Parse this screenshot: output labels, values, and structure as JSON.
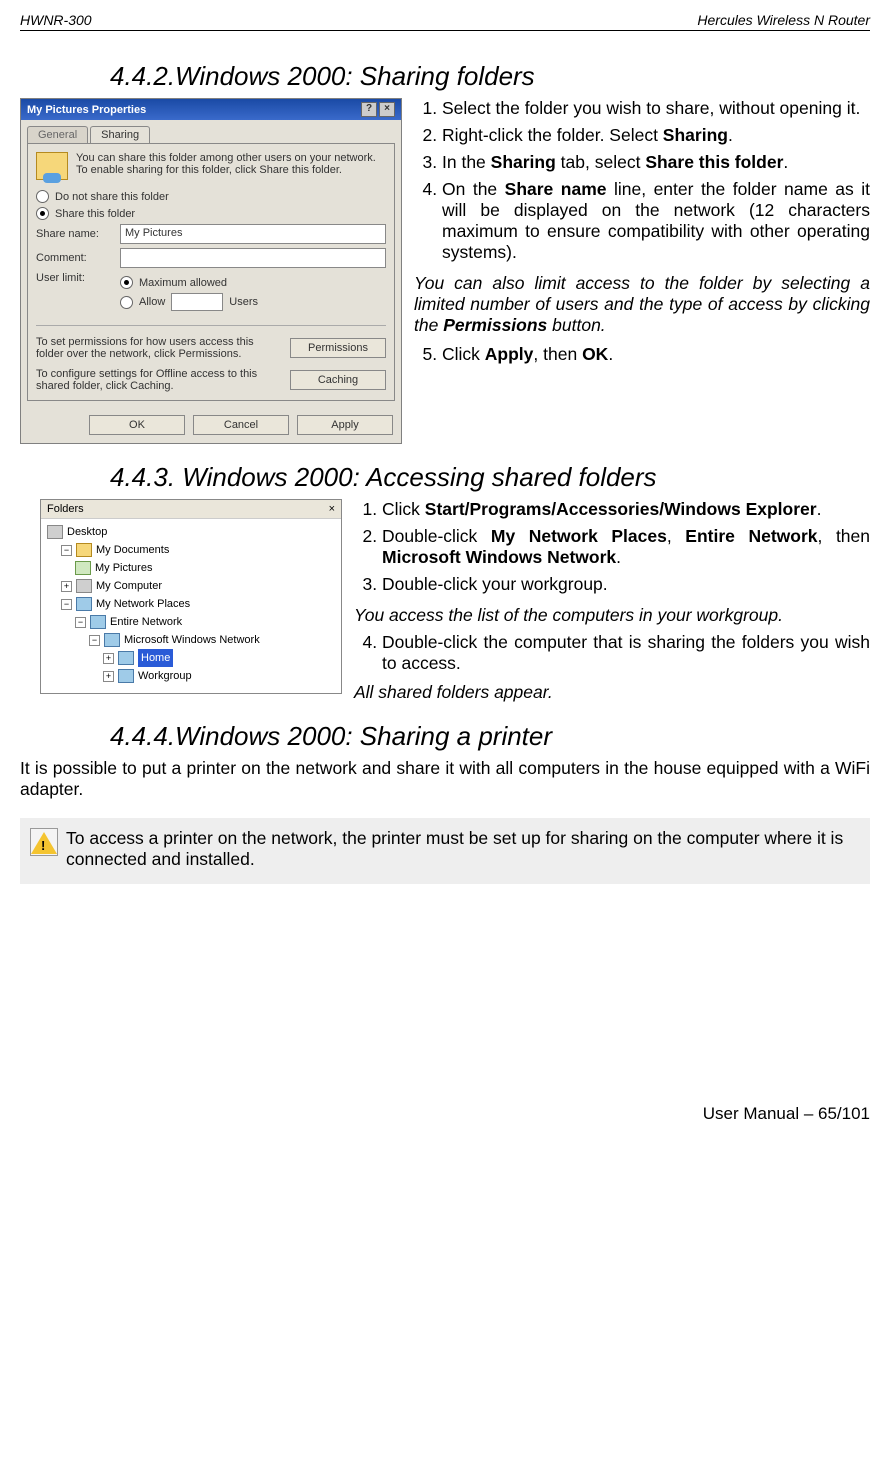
{
  "header": {
    "left": "HWNR-300",
    "right": "Hercules Wireless N Router"
  },
  "section_442": {
    "title": "4.4.2.Windows 2000: Sharing folders",
    "dialog": {
      "title": "My Pictures Properties",
      "qmark": "?",
      "xmark": "×",
      "tab_general": "General",
      "tab_sharing": "Sharing",
      "desc": "You can share this folder among other users on your network.  To enable sharing for this folder, click Share this folder.",
      "radio_noshare": "Do not share this folder",
      "radio_share": "Share this folder",
      "label_sharename": "Share name:",
      "val_sharename": "My Pictures",
      "label_comment": "Comment:",
      "label_userlimit": "User limit:",
      "radio_max": "Maximum allowed",
      "radio_allow": "Allow",
      "users_suffix": "Users",
      "perm_desc": "To set permissions for how users access this folder over the network, click Permissions.",
      "btn_perm": "Permissions",
      "cache_desc": "To configure settings for Offline access to this shared folder, click Caching.",
      "btn_cache": "Caching",
      "btn_ok": "OK",
      "btn_cancel": "Cancel",
      "btn_apply": "Apply"
    },
    "steps": {
      "s1": "Select the folder you wish to share, without opening it.",
      "s2a": "Right-click the folder.  Select ",
      "s2b": "Sharing",
      "s2c": ".",
      "s3a": "In the ",
      "s3b": "Sharing",
      "s3c": " tab, select ",
      "s3d": "Share this folder",
      "s3e": ".",
      "s4a": "On the ",
      "s4b": "Share name",
      "s4c": " line, enter the folder name as it will be displayed on the network (12 characters maximum to ensure compatibility with other operating systems).",
      "note_a": "You can also limit access to the folder by selecting a limited number of users and the type of access by clicking the ",
      "note_b": "Permissions",
      "note_c": " button.",
      "s5a": "Click ",
      "s5b": "Apply",
      "s5c": ", then ",
      "s5d": "OK",
      "s5e": "."
    }
  },
  "section_443": {
    "title": "4.4.3.  Windows 2000: Accessing shared folders",
    "tree": {
      "panel_title": "Folders",
      "close": "×",
      "desktop": "Desktop",
      "mydocs": "My Documents",
      "mypics": "My Pictures",
      "mycomp": "My Computer",
      "netplaces": "My Network Places",
      "entire": "Entire Network",
      "msnet": "Microsoft Windows Network",
      "home": "Home",
      "workgroup": "Workgroup"
    },
    "steps": {
      "s1a": "Click ",
      "s1b": "Start/Programs/Accessories/Windows Explorer",
      "s1c": ".",
      "s2a": "Double-click ",
      "s2b": "My Network Places",
      "s2c": ", ",
      "s2d": "Entire Network",
      "s2e": ", then ",
      "s2f": "Microsoft Windows Network",
      "s2g": ".",
      "s3": "Double-click your workgroup.",
      "note1": "You access the list of the computers in your workgroup.",
      "s4": "Double-click the computer that is sharing the folders you wish to access.",
      "note2": "All shared folders appear."
    }
  },
  "section_444": {
    "title": "4.4.4.Windows 2000: Sharing a printer",
    "para": "It is possible to put a printer on the network and share it with all computers in the house equipped with a WiFi adapter.",
    "warn": " To access a printer on the network, the printer must be set up for sharing on the computer where it is connected and installed."
  },
  "footer": "User Manual – 65/101"
}
